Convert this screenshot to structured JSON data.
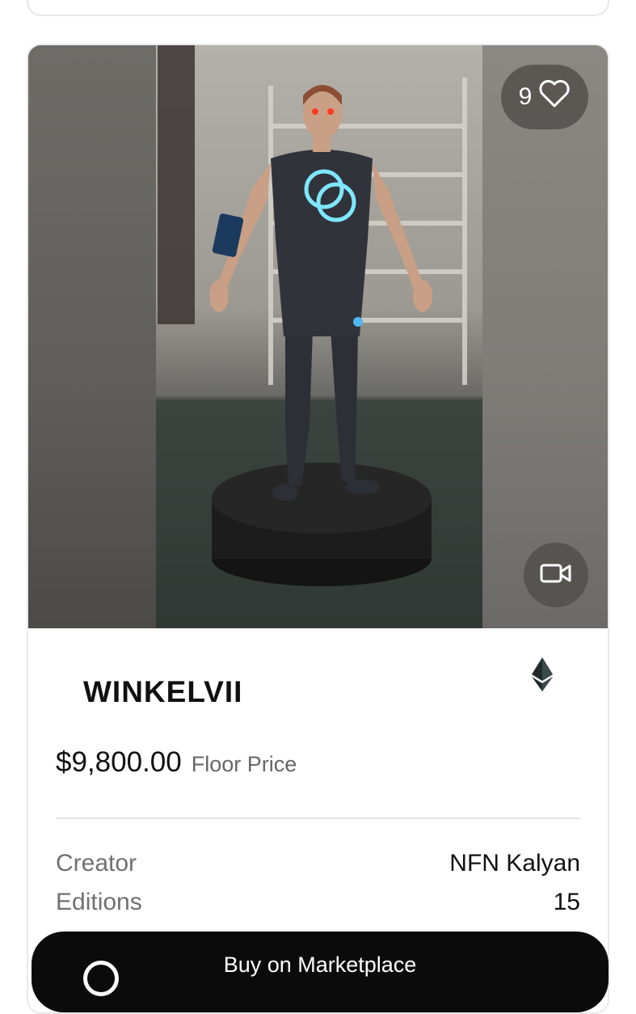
{
  "nft": {
    "likes": "9",
    "title": "WINKELVII",
    "price": "$9,800.00",
    "price_label": "Floor Price",
    "details": {
      "creator_label": "Creator",
      "creator_value": "NFN Kalyan",
      "editions_label": "Editions",
      "editions_value": "15"
    },
    "buy_label": "Buy on Marketplace"
  },
  "icons": {
    "like": "heart-icon",
    "media_type": "video-camera-icon",
    "chain": "ethereum-icon"
  },
  "colors": {
    "button_bg": "#0b0b0b",
    "pill_bg": "rgba(80,78,74,0.82)",
    "muted_text": "#707070"
  }
}
